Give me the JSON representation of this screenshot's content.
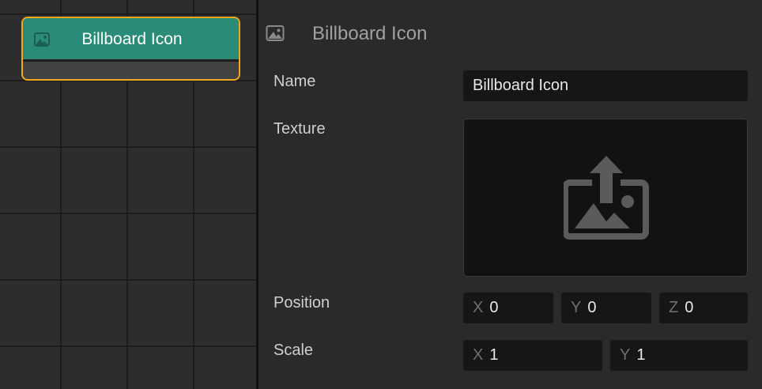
{
  "node": {
    "title": "Billboard Icon",
    "header_color": "#2a8c78",
    "border_color": "#f0a81c",
    "icon": "image-icon"
  },
  "inspector": {
    "title": "Billboard Icon",
    "icon": "image-icon",
    "name": {
      "label": "Name",
      "value": "Billboard Icon"
    },
    "texture": {
      "label": "Texture",
      "icon": "upload-image-icon"
    },
    "position": {
      "label": "Position",
      "x": {
        "axis": "X",
        "value": "0"
      },
      "y": {
        "axis": "Y",
        "value": "0"
      },
      "z": {
        "axis": "Z",
        "value": "0"
      }
    },
    "scale": {
      "label": "Scale",
      "x": {
        "axis": "X",
        "value": "1"
      },
      "y": {
        "axis": "Y",
        "value": "1"
      }
    }
  }
}
